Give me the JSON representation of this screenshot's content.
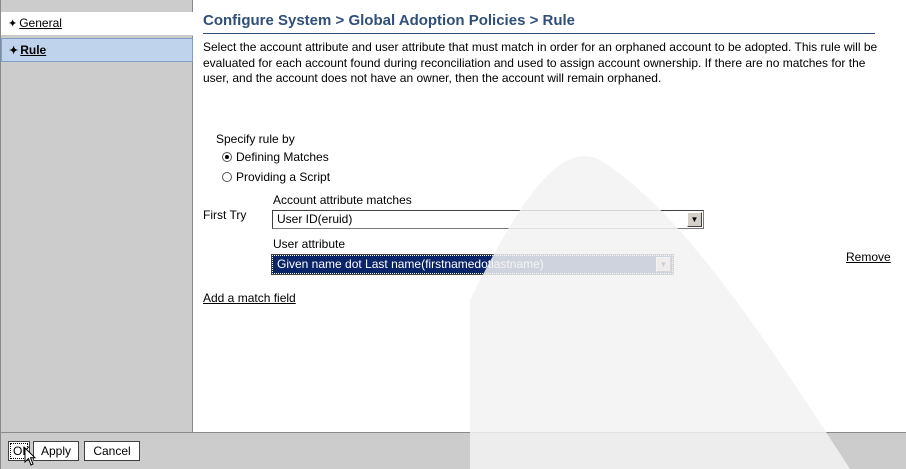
{
  "sidebar": {
    "items": [
      {
        "bullet": "✦",
        "label": "General"
      },
      {
        "bullet": "✦",
        "label": "Rule"
      }
    ]
  },
  "main": {
    "title": "Configure System > Global Adoption Policies > Rule",
    "description": "Select the account attribute and user attribute that must match in order for an orphaned account to be adopted. This rule will be evaluated for each account found during reconciliation and used to assign account ownership. If there are no matches for the user, and the account does not have an owner, then the account will remain orphaned.",
    "specify_label": "Specify rule by",
    "radio_defining": {
      "label": "Defining Matches",
      "checked": true
    },
    "radio_script": {
      "label": "Providing a Script",
      "checked": false
    },
    "first_try_label": "First Try",
    "account_attr_label": "Account attribute matches",
    "account_attr_value": "User ID(eruid)",
    "user_attr_label": "User attribute",
    "user_attr_value": "Given name dot Last name(firstnamedotlastname)",
    "remove_label": "Remove",
    "add_match_label": "Add a match field"
  },
  "buttons": {
    "ok": "OK",
    "apply": "Apply",
    "cancel": "Cancel"
  },
  "colors": {
    "title": "#2f4f7a",
    "selected_nav": "#bfd3ec",
    "selected_option": "#0a246a",
    "sidebar_bg": "#cccccc"
  }
}
